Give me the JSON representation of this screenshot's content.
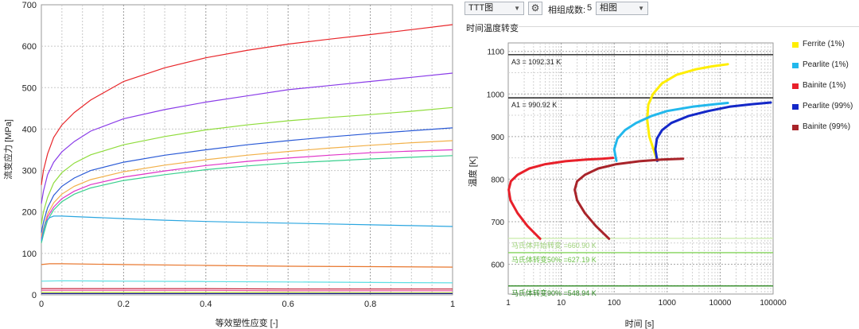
{
  "toolbar": {
    "diagram_select": "TTT图",
    "gear_icon": "gear-icon",
    "phase_count_label": "相组成数:",
    "phase_count_value": "5",
    "phase_select": "相图"
  },
  "section_title": "时间温度转变",
  "chart_data": [
    {
      "type": "line",
      "xlabel": "等效塑性应变 [-]",
      "ylabel": "流变应力 [MPa]",
      "xlim": [
        0,
        1
      ],
      "ylim": [
        0,
        700
      ],
      "xticks": [
        0,
        0.2,
        0.4,
        0.6,
        0.8,
        1
      ],
      "xtick_labels": [
        "0",
        "0.2",
        "0.4",
        "0.6",
        "0.8",
        "1"
      ],
      "yticks": [
        0,
        100,
        200,
        300,
        400,
        500,
        600,
        700
      ],
      "ytick_labels": [
        "0",
        "100",
        "200",
        "300",
        "400",
        "500",
        "600",
        "700"
      ],
      "grid": true,
      "series": [
        {
          "color": "#e8262a",
          "x": [
            0,
            0.005,
            0.015,
            0.03,
            0.05,
            0.08,
            0.12,
            0.2,
            0.3,
            0.4,
            0.5,
            0.6,
            0.7,
            0.8,
            0.9,
            1.0
          ],
          "y": [
            265,
            300,
            340,
            380,
            410,
            440,
            470,
            515,
            548,
            572,
            590,
            605,
            617,
            628,
            640,
            652
          ]
        },
        {
          "color": "#8a3ce8",
          "x": [
            0,
            0.005,
            0.015,
            0.03,
            0.05,
            0.08,
            0.12,
            0.2,
            0.3,
            0.4,
            0.5,
            0.6,
            0.7,
            0.8,
            0.9,
            1.0
          ],
          "y": [
            220,
            250,
            290,
            320,
            345,
            370,
            395,
            425,
            447,
            465,
            480,
            495,
            505,
            515,
            525,
            535
          ]
        },
        {
          "color": "#8fdc3c",
          "x": [
            0,
            0.005,
            0.015,
            0.03,
            0.05,
            0.08,
            0.12,
            0.2,
            0.3,
            0.4,
            0.5,
            0.6,
            0.7,
            0.8,
            0.9,
            1.0
          ],
          "y": [
            170,
            200,
            235,
            270,
            295,
            318,
            338,
            362,
            382,
            398,
            410,
            420,
            428,
            435,
            443,
            452
          ]
        },
        {
          "color": "#2a5ad6",
          "x": [
            0,
            0.005,
            0.015,
            0.03,
            0.05,
            0.08,
            0.12,
            0.2,
            0.3,
            0.4,
            0.5,
            0.6,
            0.7,
            0.8,
            0.9,
            1.0
          ],
          "y": [
            150,
            175,
            210,
            240,
            262,
            282,
            300,
            320,
            337,
            350,
            362,
            372,
            381,
            389,
            396,
            403
          ]
        },
        {
          "color": "#f2b14a",
          "x": [
            0,
            0.005,
            0.015,
            0.03,
            0.05,
            0.08,
            0.12,
            0.2,
            0.3,
            0.4,
            0.5,
            0.6,
            0.7,
            0.8,
            0.9,
            1.0
          ],
          "y": [
            140,
            160,
            195,
            222,
            243,
            262,
            278,
            297,
            313,
            326,
            337,
            346,
            354,
            361,
            367,
            372
          ]
        },
        {
          "color": "#e035c8",
          "x": [
            0,
            0.005,
            0.015,
            0.03,
            0.05,
            0.08,
            0.12,
            0.2,
            0.3,
            0.4,
            0.5,
            0.6,
            0.7,
            0.8,
            0.9,
            1.0
          ],
          "y": [
            135,
            155,
            188,
            212,
            232,
            250,
            266,
            284,
            299,
            312,
            322,
            330,
            337,
            343,
            347,
            350
          ]
        },
        {
          "color": "#39d08e",
          "x": [
            0,
            0.005,
            0.015,
            0.03,
            0.05,
            0.08,
            0.12,
            0.2,
            0.3,
            0.4,
            0.5,
            0.6,
            0.7,
            0.8,
            0.9,
            1.0
          ],
          "y": [
            125,
            145,
            180,
            205,
            225,
            243,
            258,
            276,
            290,
            302,
            311,
            318,
            323,
            328,
            332,
            336
          ]
        },
        {
          "color": "#2ba6e0",
          "x": [
            0,
            0.01,
            0.02,
            0.03,
            0.05,
            0.1,
            0.2,
            0.3,
            0.4,
            0.5,
            0.6,
            0.7,
            0.8,
            0.9,
            1.0
          ],
          "y": [
            130,
            175,
            186,
            190,
            190,
            188,
            184,
            180,
            177,
            175,
            173,
            171,
            169,
            167,
            165
          ]
        },
        {
          "color": "#e8772e",
          "x": [
            0,
            0.02,
            0.05,
            0.2,
            0.4,
            0.6,
            0.8,
            1.0
          ],
          "y": [
            73,
            75,
            75,
            73,
            71,
            69,
            68,
            67
          ]
        },
        {
          "color": "#5de0e4",
          "x": [
            0,
            0.05,
            0.2,
            0.4,
            0.6,
            0.8,
            1.0
          ],
          "y": [
            33,
            34,
            33,
            32,
            31,
            30,
            29
          ]
        },
        {
          "color": "#c01a30",
          "x": [
            0,
            0.2,
            0.4,
            0.6,
            0.8,
            1.0
          ],
          "y": [
            15,
            15,
            15,
            14,
            14,
            14
          ]
        },
        {
          "color": "#e94d9a",
          "x": [
            0,
            0.2,
            0.4,
            0.6,
            0.8,
            1.0
          ],
          "y": [
            11,
            11,
            11,
            10,
            10,
            10
          ]
        },
        {
          "color": "#c9e53c",
          "x": [
            0,
            0.2,
            0.4,
            0.6,
            0.8,
            1.0
          ],
          "y": [
            6,
            6,
            6,
            6,
            5,
            5
          ]
        },
        {
          "color": "#1a1a9c",
          "x": [
            0,
            0.2,
            0.4,
            0.6,
            0.8,
            1.0
          ],
          "y": [
            3,
            3,
            3,
            3,
            3,
            3
          ]
        }
      ]
    },
    {
      "type": "line",
      "xlabel": "时间 [s]",
      "ylabel": "温度 [K]",
      "xscale": "log",
      "xlim": [
        1,
        100000
      ],
      "ylim": [
        530,
        1120
      ],
      "xticks": [
        1,
        10,
        100,
        1000,
        10000,
        100000
      ],
      "xtick_labels": [
        "1",
        "10",
        "100",
        "1000",
        "10000",
        "100000"
      ],
      "yticks": [
        600,
        700,
        800,
        900,
        1000,
        1100
      ],
      "ytick_labels": [
        "600",
        "700",
        "800",
        "900",
        "1000",
        "1100"
      ],
      "grid": true,
      "legend": "right",
      "series": [
        {
          "name": "Ferrite (1%)",
          "color": "#ffee00",
          "x": [
            650,
            560,
            460,
            420,
            440,
            540,
            800,
            1500,
            3500,
            7000,
            14000
          ],
          "y": [
            843,
            868,
            900,
            940,
            975,
            1000,
            1025,
            1045,
            1058,
            1065,
            1070
          ]
        },
        {
          "name": "Pearlite (1%)",
          "color": "#22b8ec",
          "x": [
            110,
            100,
            115,
            160,
            260,
            500,
            1000,
            3000,
            8000,
            14000
          ],
          "y": [
            843,
            870,
            895,
            915,
            932,
            948,
            960,
            970,
            976,
            979
          ]
        },
        {
          "name": "Bainite (1%)",
          "color": "#e8202a",
          "x": [
            4,
            2.3,
            1.5,
            1.1,
            1.02,
            1.12,
            1.5,
            2.5,
            5,
            12,
            30,
            60,
            95
          ],
          "y": [
            660,
            690,
            720,
            750,
            775,
            795,
            810,
            825,
            835,
            842,
            846,
            848,
            850
          ]
        },
        {
          "name": "Pearlite (99%)",
          "color": "#1428c8",
          "x": [
            650,
            600,
            640,
            800,
            1200,
            2500,
            6000,
            15000,
            40000,
            90000
          ],
          "y": [
            843,
            870,
            895,
            915,
            932,
            948,
            960,
            970,
            976,
            980
          ]
        },
        {
          "name": "Bainite (99%)",
          "color": "#a8242a",
          "x": [
            80,
            45,
            28,
            20,
            18,
            20,
            28,
            50,
            110,
            300,
            800,
            2000
          ],
          "y": [
            660,
            690,
            720,
            750,
            775,
            795,
            810,
            825,
            835,
            842,
            846,
            848
          ]
        }
      ],
      "reference_lines": [
        {
          "label": "A3 = 1092.31 K",
          "value": 1092.31,
          "color": "#222222",
          "label_color": "#222222"
        },
        {
          "label": "A1 = 990.92 K",
          "value": 990.92,
          "color": "#222222",
          "label_color": "#222222"
        },
        {
          "label": "马氏体开始转变 =660.90 K",
          "value": 660.9,
          "color": "#cdeeb0",
          "label_color": "#9ed27a"
        },
        {
          "label": "马氏体转变50% =627.19 K",
          "value": 627.19,
          "color": "#84d45a",
          "label_color": "#6cc048"
        },
        {
          "label": "马氏体转变90% =548.94 K",
          "value": 548.94,
          "color": "#2e8a22",
          "label_color": "#2e8a22"
        }
      ]
    }
  ]
}
